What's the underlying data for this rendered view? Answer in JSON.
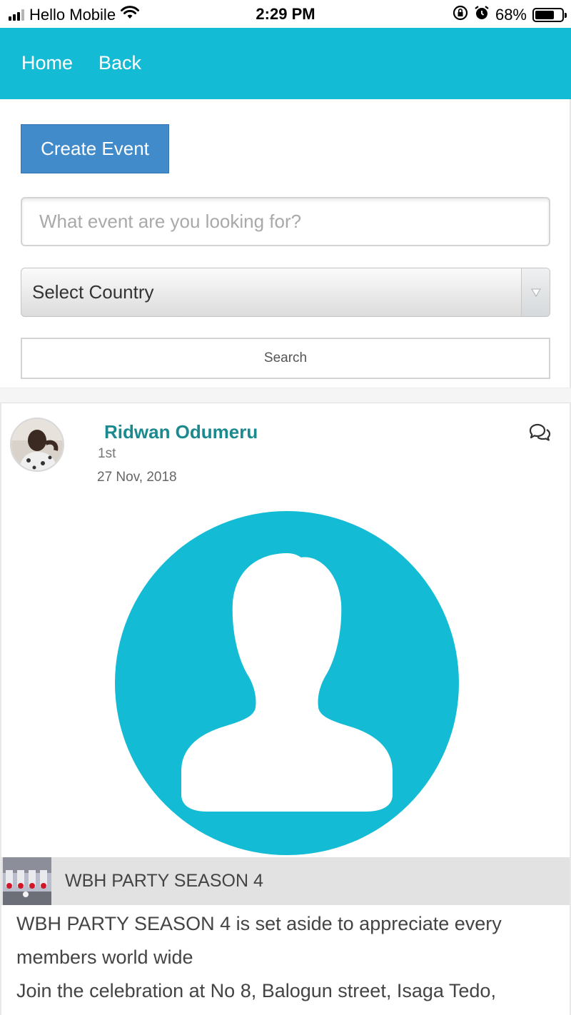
{
  "status_bar": {
    "carrier": "Hello Mobile",
    "time": "2:29 PM",
    "battery_percent": "68%",
    "battery_level": 0.68,
    "icons": [
      "signal-icon",
      "wifi-icon",
      "orientation-lock-icon",
      "alarm-icon",
      "battery-icon"
    ]
  },
  "navbar": {
    "home_label": "Home",
    "back_label": "Back",
    "background_color": "#14bbd5"
  },
  "form": {
    "create_event_label": "Create Event",
    "search_placeholder": "What event are you looking for?",
    "country_select_value": "Select Country",
    "search_button_label": "Search",
    "create_button_color": "#418bcb"
  },
  "post": {
    "author": "Ridwan Odumeru",
    "rank": "1st",
    "date": "27 Nov, 2018",
    "author_color": "#1b8a8f",
    "event_image": "default-user-avatar",
    "event_title": "WBH PARTY SEASON 4",
    "description_lines": [
      "WBH PARTY SEASON 4 is set aside to appreciate every members world wide",
      "Join the celebration at No 8, Balogun street, Isaga Tedo,"
    ]
  }
}
